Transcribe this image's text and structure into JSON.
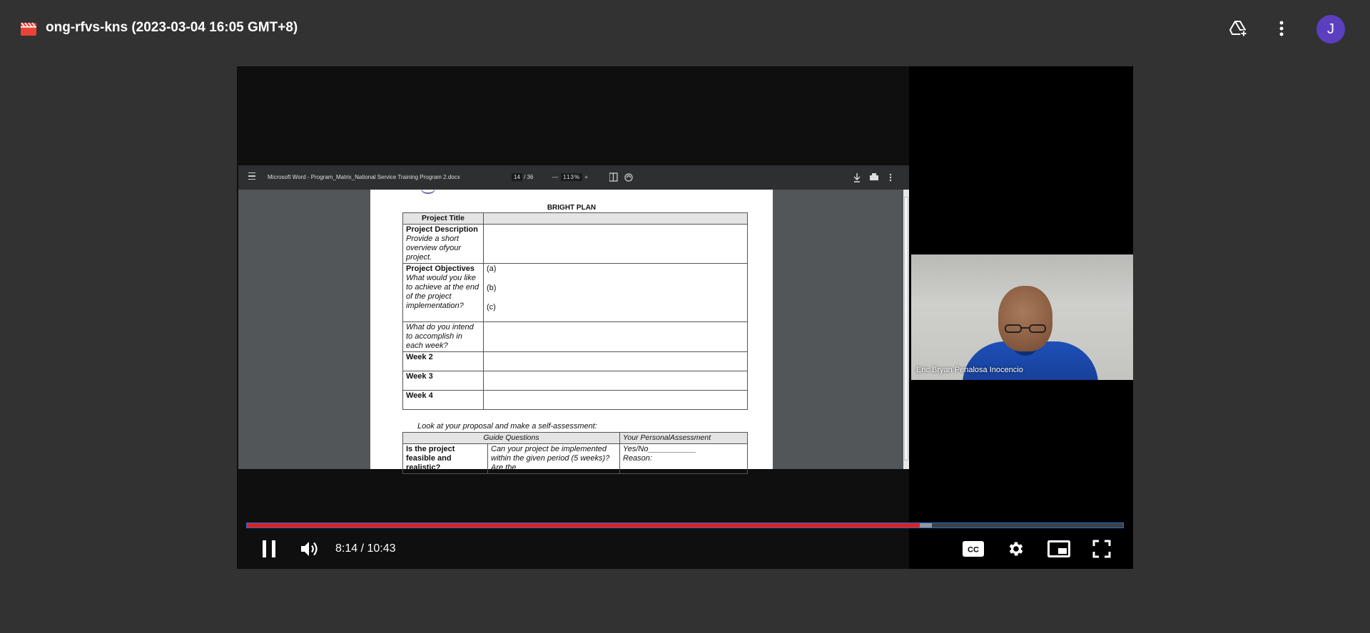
{
  "header": {
    "title": "ong-rfvs-kns (2023-03-04 16:05 GMT+8)",
    "file_icon": "video-file-icon",
    "add_to_drive_icon": "add-to-drive-icon",
    "more_icon": "more-vertical-icon",
    "avatar_letter": "J",
    "avatar_color": "#5b3fbf"
  },
  "pdf_viewer": {
    "doc_name": "Microsoft Word - Program_Matrix_National Service Training Program 2.docx",
    "page_current": "14",
    "page_separator": "/",
    "page_total": "36",
    "zoom": "113%"
  },
  "document": {
    "title": "BRIGHT PLAN",
    "table1": {
      "header": "Project Title",
      "rows": [
        {
          "label_bold": "Project Description",
          "label_italic": "Provide a short overview ofyour project.",
          "value": ""
        },
        {
          "label_bold": "Project Objectives",
          "label_italic": "What would you like to achieve at the end of the project implementation?",
          "value_a": "(a)",
          "value_b": "(b)",
          "value_c": "(c)"
        },
        {
          "label_italic": "What do you intend to accomplish in each week?"
        },
        {
          "label_bold": "Week 2"
        },
        {
          "label_bold": "Week 3"
        },
        {
          "label_bold": "Week 4"
        }
      ]
    },
    "instruction": "Look at your proposal and make a self-assessment:",
    "table2": {
      "col1": "Guide Questions",
      "col2": "Your PersonalAssessment",
      "row1_label": "Is the project feasible and realistic?",
      "row1_question": "Can your project be implemented within the given period (5 weeks)? Are the",
      "row1_answer_1": "Yes/No___________",
      "row1_answer_2": "Reason:"
    }
  },
  "participant": {
    "name": "Eric Bryan Penalosa Inocencio"
  },
  "player": {
    "current_time": "8:14",
    "duration": "10:43",
    "time_display": "8:14 / 10:43",
    "played_fraction": 0.768,
    "buffered_fraction": 0.782,
    "progress_color": "#e0201b",
    "focus_outline_color": "#1a73e8",
    "controls": [
      "pause-icon",
      "volume-icon",
      "captions-icon",
      "settings-icon",
      "miniplayer-icon",
      "fullscreen-icon"
    ]
  }
}
